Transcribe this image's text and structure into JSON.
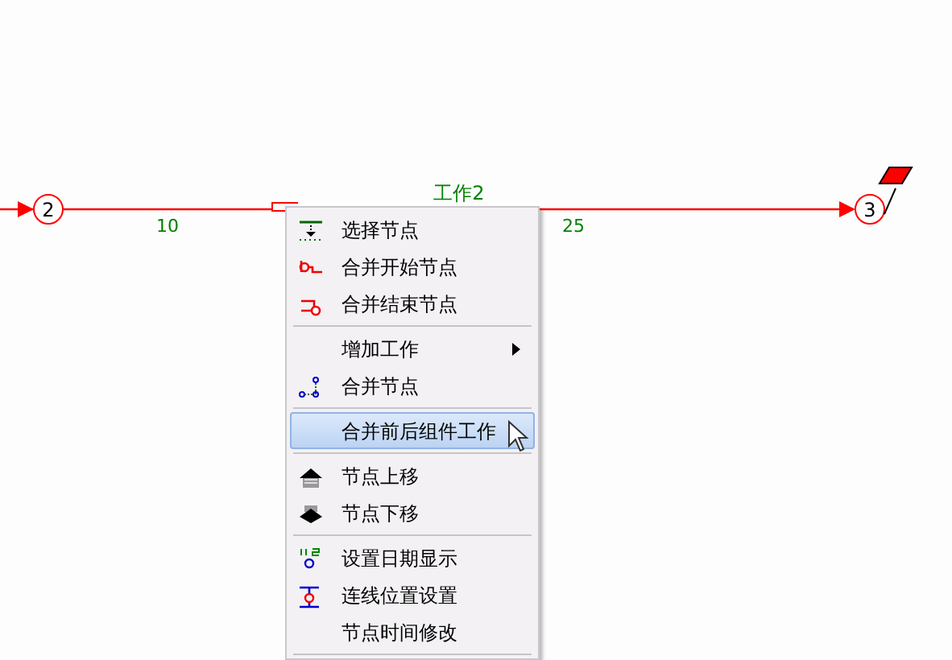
{
  "diagram": {
    "work_label": "工作2",
    "nodes": [
      {
        "label": "2"
      },
      {
        "label": "3"
      }
    ],
    "durations": [
      "10",
      "25"
    ]
  },
  "context_menu": {
    "items": [
      {
        "kind": "item",
        "label": "选择节点",
        "selected": false
      },
      {
        "kind": "item",
        "label": "合并开始节点",
        "selected": false
      },
      {
        "kind": "item",
        "label": "合并结束节点",
        "selected": false
      },
      {
        "kind": "separator"
      },
      {
        "kind": "item",
        "label": "增加工作",
        "selected": false,
        "submenu": true
      },
      {
        "kind": "item",
        "label": "合并节点",
        "selected": false
      },
      {
        "kind": "separator"
      },
      {
        "kind": "item",
        "label": "合并前后组件工作",
        "selected": true
      },
      {
        "kind": "separator"
      },
      {
        "kind": "item",
        "label": "节点上移",
        "selected": false
      },
      {
        "kind": "item",
        "label": "节点下移",
        "selected": false
      },
      {
        "kind": "separator"
      },
      {
        "kind": "item",
        "label": "设置日期显示",
        "selected": false
      },
      {
        "kind": "item",
        "label": "连线位置设置",
        "selected": false
      },
      {
        "kind": "item",
        "label": "节点时间修改",
        "selected": false
      },
      {
        "kind": "separator"
      }
    ]
  }
}
